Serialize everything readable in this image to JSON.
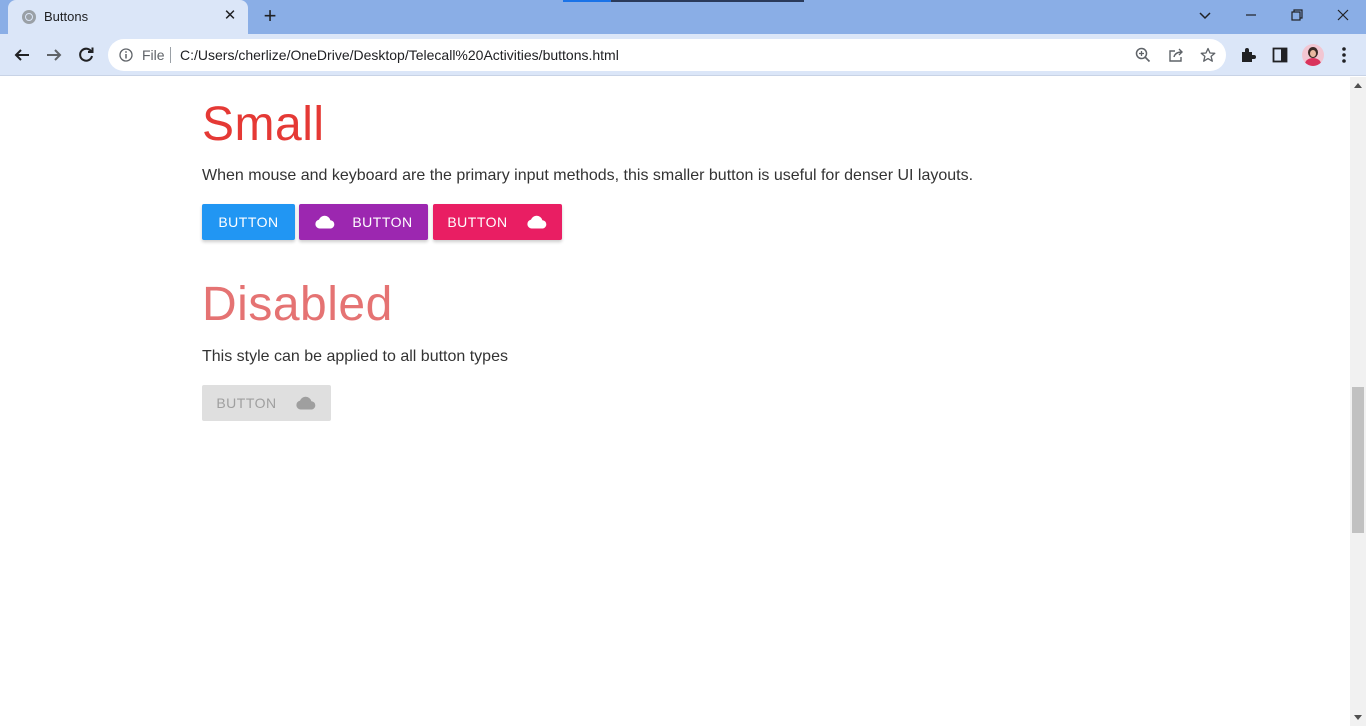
{
  "browser": {
    "tab": {
      "title": "Buttons",
      "close_icon": "close-icon"
    },
    "new_tab_icon": "plus-icon",
    "window_controls": [
      "chevron-down-icon",
      "minimize-icon",
      "restore-icon",
      "close-icon"
    ],
    "nav": [
      "back-icon",
      "forward-icon",
      "reload-icon"
    ],
    "omnibox": {
      "scheme": "File",
      "url": "C:/Users/cherlize/OneDrive/Desktop/Telecall%20Activities/buttons.html"
    },
    "toolbar_icons": [
      "zoom-icon",
      "share-icon",
      "star-icon",
      "extensions-icon",
      "side-panel-icon",
      "avatar",
      "menu-icon"
    ]
  },
  "content": {
    "small": {
      "heading": "Small",
      "description": "When mouse and keyboard are the primary input methods, this smaller button is useful for denser UI layouts.",
      "buttons": [
        {
          "label": "BUTTON",
          "color": "#2196f3",
          "icon": null
        },
        {
          "label": "BUTTON",
          "color": "#9c27b0",
          "icon": "cloud-icon",
          "icon_position": "left"
        },
        {
          "label": "BUTTON",
          "color": "#e91e63",
          "icon": "cloud-icon",
          "icon_position": "right"
        }
      ]
    },
    "disabled": {
      "heading": "Disabled",
      "description": "This style can be applied to all button types",
      "button": {
        "label": "BUTTON",
        "color": "#dfdfdf",
        "icon": "cloud-icon",
        "icon_position": "right"
      }
    }
  },
  "colors": {
    "heading_small": "#e53935",
    "heading_disabled": "#e57373",
    "tab_strip": "#8aaee6",
    "toolbar": "#dbe6f8"
  },
  "scroll_position": 0.48
}
